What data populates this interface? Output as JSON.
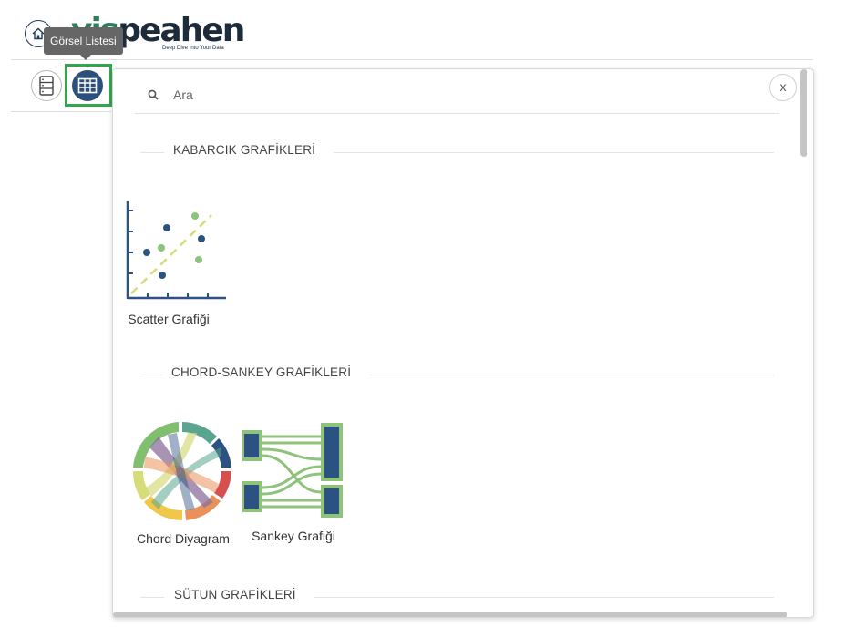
{
  "header": {
    "logo_prefix": "vis",
    "logo_text": "peahen",
    "tagline": "Deep Dive Into Your Data",
    "tooltip": "Görsel Listesi"
  },
  "panel": {
    "close_label": "x",
    "search_placeholder": "Ara",
    "sections": [
      {
        "title": "KABARCIK GRAFİKLERİ",
        "items": [
          "Scatter Grafiği"
        ]
      },
      {
        "title": "CHORD-SANKEY GRAFİKLERİ",
        "items": [
          "Chord Diyagram",
          "Sankey Grafiği"
        ]
      },
      {
        "title": "SÜTUN GRAFİKLERİ",
        "items": []
      }
    ]
  },
  "colors": {
    "brand_dark": "#1f3b5c",
    "brand_green": "#2e7d5b",
    "highlight": "#33a64c",
    "chart_blue": "#2c5282",
    "chart_green": "#8fc27a",
    "chart_yellow": "#d7dc7a"
  }
}
